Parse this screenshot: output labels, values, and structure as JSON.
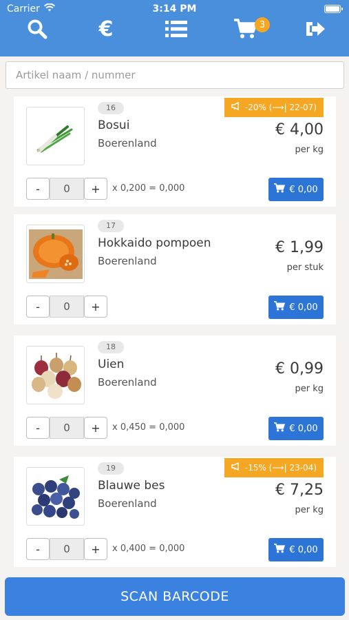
{
  "status": {
    "carrier": "Carrier",
    "time": "3:14 PM"
  },
  "nav": {
    "search_icon": "search-icon",
    "euro_symbol": "€",
    "cart_count": "3"
  },
  "search": {
    "placeholder": "Artikel naam / nummer"
  },
  "products": [
    {
      "number": "16",
      "name": "Bosui",
      "supplier": "Boerenland",
      "promo": "-20% (⟶| 22-07)",
      "price": "€ 4,00",
      "unit": "per kg",
      "qty": "0",
      "calc": "x 0,200 = 0,000",
      "cart_label": "€ 0,00"
    },
    {
      "number": "17",
      "name": "Hokkaido pompoen",
      "supplier": "Boerenland",
      "promo": "",
      "price": "€ 1,99",
      "unit": "per stuk",
      "qty": "0",
      "calc": "",
      "cart_label": "€ 0,00"
    },
    {
      "number": "18",
      "name": "Uien",
      "supplier": "Boerenland",
      "promo": "",
      "price": "€ 0,99",
      "unit": "per kg",
      "qty": "0",
      "calc": "x 0,450 = 0,000",
      "cart_label": "€ 0,00"
    },
    {
      "number": "19",
      "name": "Blauwe bes",
      "supplier": "Boerenland",
      "promo": "-15% (⟶| 23-04)",
      "price": "€ 7,25",
      "unit": "per kg",
      "qty": "0",
      "calc": "x 0,400 = 0,000",
      "cart_label": "€ 0,00"
    }
  ],
  "qty_buttons": {
    "minus": "-",
    "plus": "+"
  },
  "scan_button": "SCAN BARCODE",
  "colors": {
    "header": "#4a8fdc",
    "promo": "#f5a623",
    "cart_button": "#2c75d6",
    "scan_button": "#3b82e0"
  }
}
